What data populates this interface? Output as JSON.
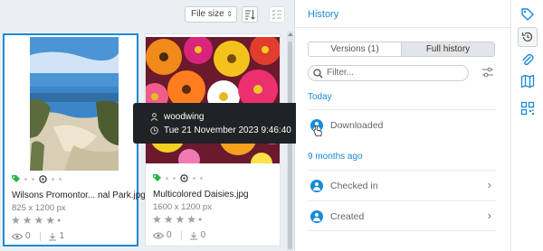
{
  "toolbar": {
    "sort_label": "File size",
    "sort_icon": "sort-icon",
    "select_icon": "checklist-icon"
  },
  "assets": [
    {
      "name": "Wilsons Promontor... nal Park.jpg",
      "dimensions": "825 x 1200 px",
      "rating": 0,
      "views": "0",
      "downloads": "1",
      "selected": true
    },
    {
      "name": "Multicolored Daisies.jpg",
      "dimensions": "1600 x 1200 px",
      "rating": 0,
      "views": "0",
      "downloads": "0",
      "selected": false
    }
  ],
  "tooltip": {
    "user": "woodwing",
    "datetime": "Tue 21 November 2023 9:46:40"
  },
  "history": {
    "title": "History",
    "tabs": [
      {
        "label": "Versions (1)",
        "active": false
      },
      {
        "label": "Full history",
        "active": true
      }
    ],
    "filter_placeholder": "Filter...",
    "sections": [
      {
        "label": "Today",
        "rows": [
          {
            "label": "Downloaded",
            "chevron": false
          }
        ]
      },
      {
        "label": "9 months ago",
        "rows": [
          {
            "label": "Checked in",
            "chevron": true
          },
          {
            "label": "Created",
            "chevron": true
          }
        ]
      }
    ]
  },
  "rail": [
    "tag-icon",
    "history-icon",
    "paperclip-icon",
    "map-icon",
    "qr-code-icon"
  ],
  "colors": {
    "accent": "#1a8ad8",
    "tooltip_bg": "#1f2326",
    "tag_green": "#2bb34a"
  }
}
